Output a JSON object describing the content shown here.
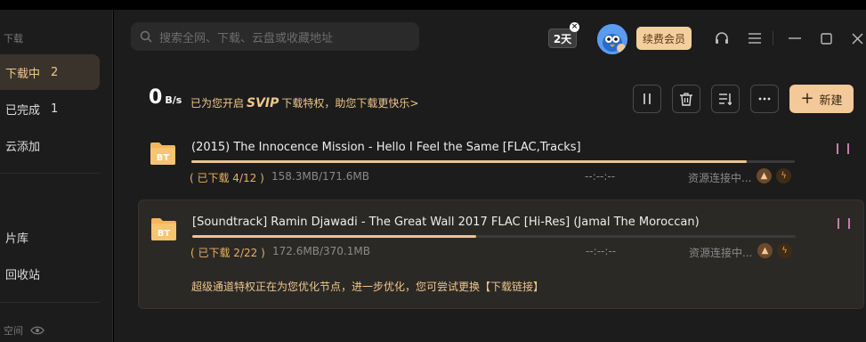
{
  "sidebar": {
    "section_download": "下载",
    "items": [
      {
        "label": "下载中",
        "count": "2"
      },
      {
        "label": "已完成",
        "count": "1"
      },
      {
        "label": "云添加",
        "count": ""
      },
      {
        "label": "片库",
        "count": ""
      },
      {
        "label": "回收站",
        "count": ""
      }
    ],
    "section_space": "空间"
  },
  "search": {
    "placeholder": "搜索全网、下载、云盘或收藏地址"
  },
  "header": {
    "days_badge": "2天",
    "renew_label": "续费会员"
  },
  "speed": {
    "value": "0",
    "unit": "B/s",
    "message_prefix": "已为您开启",
    "message_brand": "SVIP",
    "message_suffix": "下载特权，助您下载更快乐>"
  },
  "toolbar": {
    "new_label": "新建"
  },
  "tasks": [
    {
      "name": "(2015) The Innocence Mission - Hello I Feel the Same [FLAC,Tracks]",
      "status": "( 已下载 4/12 )",
      "size": "158.3MB/171.6MB",
      "eta": "--:--:--",
      "resource": "资源连接中...",
      "progress": 0.92
    },
    {
      "name": "[Soundtrack] Ramin Djawadi - The Great Wall 2017 FLAC [Hi-Res] (Jamal The Moroccan)",
      "status": "( 已下载 2/22 )",
      "size": "172.6MB/370.1MB",
      "eta": "--:--:--",
      "resource": "资源连接中...",
      "progress": 0.47,
      "hint": "超级通道特权正在为您优化节点，进一步优化，您可尝试更换【下载链接】"
    }
  ],
  "file_badge": "BT",
  "colors": {
    "accent": "#f3c99a",
    "status": "#e9b060",
    "background": "#1c1c1c"
  }
}
